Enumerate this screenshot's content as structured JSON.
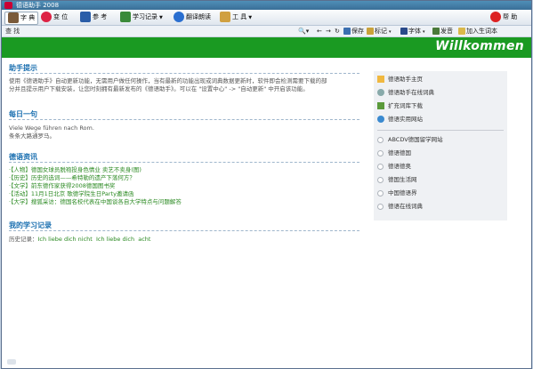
{
  "window": {
    "title": "德语助手 2008"
  },
  "toolbar": {
    "items": [
      {
        "label": "字 典",
        "icon": "dictionary-icon",
        "color": "#7a5a3a"
      },
      {
        "label": "变 位",
        "icon": "conjugation-icon",
        "color": "#d24"
      },
      {
        "label": "参 考",
        "icon": "reference-icon",
        "color": "#2a5da8"
      },
      {
        "label": "学习记录",
        "icon": "study-record-icon",
        "color": "#3a8a3a"
      },
      {
        "label": "翻译朗读",
        "icon": "translate-read-icon",
        "color": "#2a6fd0"
      },
      {
        "label": "工 具",
        "icon": "tools-icon",
        "color": "#d0a040"
      }
    ],
    "help_label": "帮 助"
  },
  "searchbar": {
    "label": "查 找",
    "actions": [
      {
        "label": "保存",
        "icon": "save-icon"
      },
      {
        "label": "标记",
        "icon": "bookmark-icon"
      },
      {
        "label": "字体",
        "icon": "font-icon"
      },
      {
        "label": "发音",
        "icon": "pronounce-icon"
      },
      {
        "label": "加入生词本",
        "icon": "add-vocab-icon"
      }
    ]
  },
  "banner": {
    "text": "Willkommen",
    "color": "#1a9a22"
  },
  "sections": {
    "tips": {
      "title": "助手提示",
      "lines": [
        "使用《德语助手》自动更新功能，无需用户做任何操作，当有最新的功能出现或词典数据更新时，软件即会检测需要下载的部",
        "分并且提示用户下载安装，让您时刻拥有最新发布的《德语助手》。可以在 \"设置中心\" -> \"自动更新\" 中开启该功能。"
      ]
    },
    "daily": {
      "title": "每日一句",
      "de": "Viele Wege führen nach Rom.",
      "zh": "条条大路通罗马。"
    },
    "news": {
      "title": "德语资讯",
      "items": [
        "·【人物】德国女球员脱袍投身色情业 卖艺不卖身(图)",
        "·【历史】历史的选词——希特勒的遗产下落何方？",
        "·【文学】前东德作家获得2008德国图书奖",
        "·【活动】11月1日北京 歌德学院生日Party邀请函",
        "·【大学】搜狐采访：德国名校代表在中国谈各自大学特点与问题解答"
      ]
    },
    "study": {
      "title": "我的学习记录",
      "prefix": "历史记录：",
      "words": [
        "Ich liebe dich nicht",
        "Ich liebe dich",
        "acht"
      ]
    }
  },
  "sidebar": {
    "links": [
      {
        "label": "德语助手主页",
        "icon": "home-icon"
      },
      {
        "label": "德语助手在线词典",
        "icon": "search-icon"
      },
      {
        "label": "扩充词库下载",
        "icon": "download-icon"
      },
      {
        "label": "德语实用网站",
        "icon": "globe-icon"
      }
    ],
    "sites": [
      "ABCDV德国留学网站",
      "德语德国",
      "德语德奥",
      "德国生活网",
      "中国德语界",
      "德语在线词典"
    ]
  }
}
